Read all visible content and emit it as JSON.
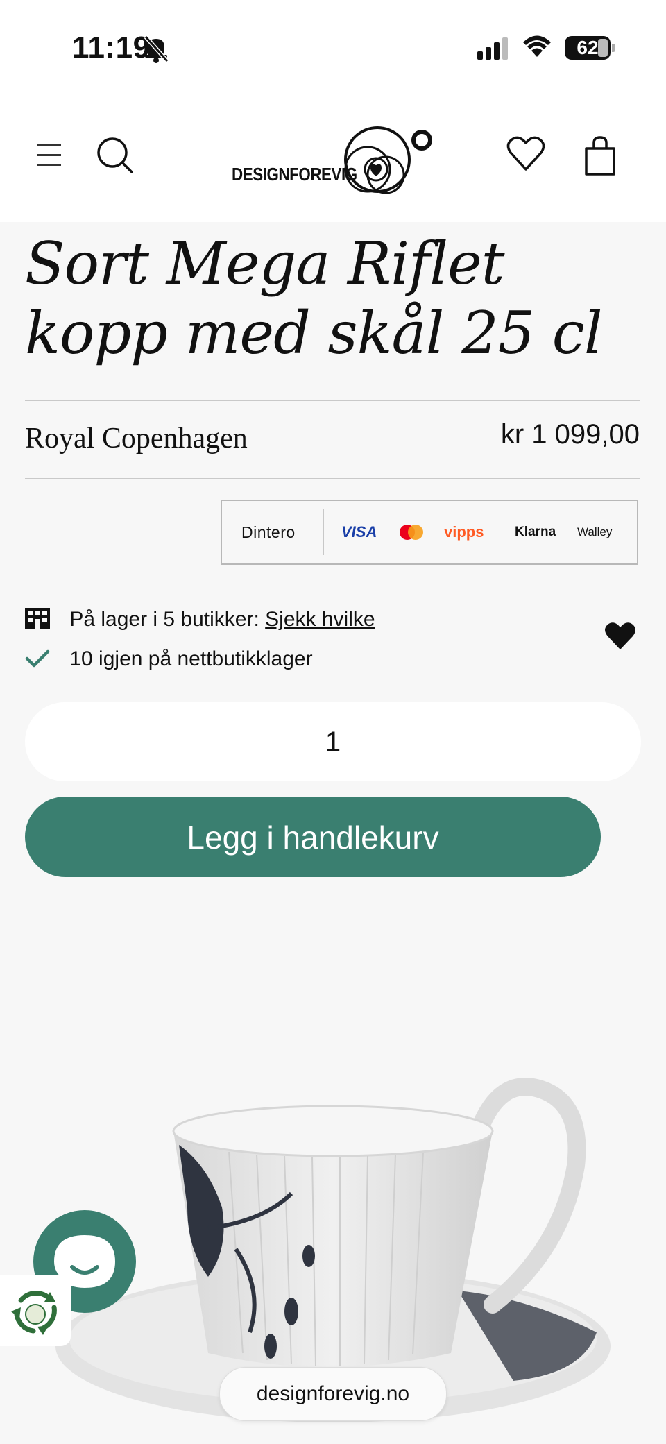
{
  "status_bar": {
    "time": "11:19",
    "battery": "62"
  },
  "header": {
    "logo_text": "DESIGNFOREVIG"
  },
  "product": {
    "title": "Sort Mega Riflet kopp med skål 25 cl",
    "brand": "Royal Copenhagen",
    "price": "kr 1 099,00"
  },
  "payments": [
    "Dintero",
    "VISA",
    "vipps",
    "Klarna",
    "Walley"
  ],
  "stock": {
    "stores_text": "På lager i 5 butikker:",
    "stores_link": "Sjekk hvilke",
    "online_text": "10 igjen på nettbutikklager"
  },
  "quantity": "1",
  "add_to_cart_label": "Legg i handlekurv",
  "url": "designforevig.no",
  "colors": {
    "accent": "#3a7f70",
    "background": "#f7f7f7"
  }
}
